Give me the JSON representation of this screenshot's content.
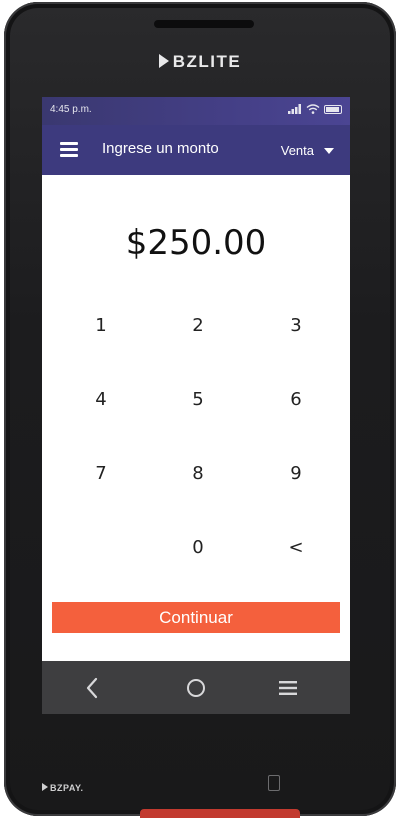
{
  "device": {
    "brand_top": "BZLITE",
    "brand_bottom": "BZPAY."
  },
  "status_bar": {
    "time": "4:45 p.m.",
    "icons": [
      "signal-icon",
      "wifi-icon",
      "battery-icon"
    ]
  },
  "app_bar": {
    "menu_icon": "hamburger-menu-icon",
    "title": "Ingrese un monto",
    "mode_label": "Venta",
    "mode_icon": "caret-down-icon"
  },
  "amount": {
    "display": "$250.00"
  },
  "keypad": {
    "keys": [
      "1",
      "2",
      "3",
      "4",
      "5",
      "6",
      "7",
      "8",
      "9",
      "0",
      "<"
    ]
  },
  "actions": {
    "continue_label": "Continuar"
  },
  "nav_bar": {
    "icons": [
      "back-icon",
      "home-icon",
      "menu-icon"
    ]
  },
  "colors": {
    "header": "#3d3a7e",
    "primary_button": "#f4603d",
    "nav_bar": "#3e3e40"
  }
}
